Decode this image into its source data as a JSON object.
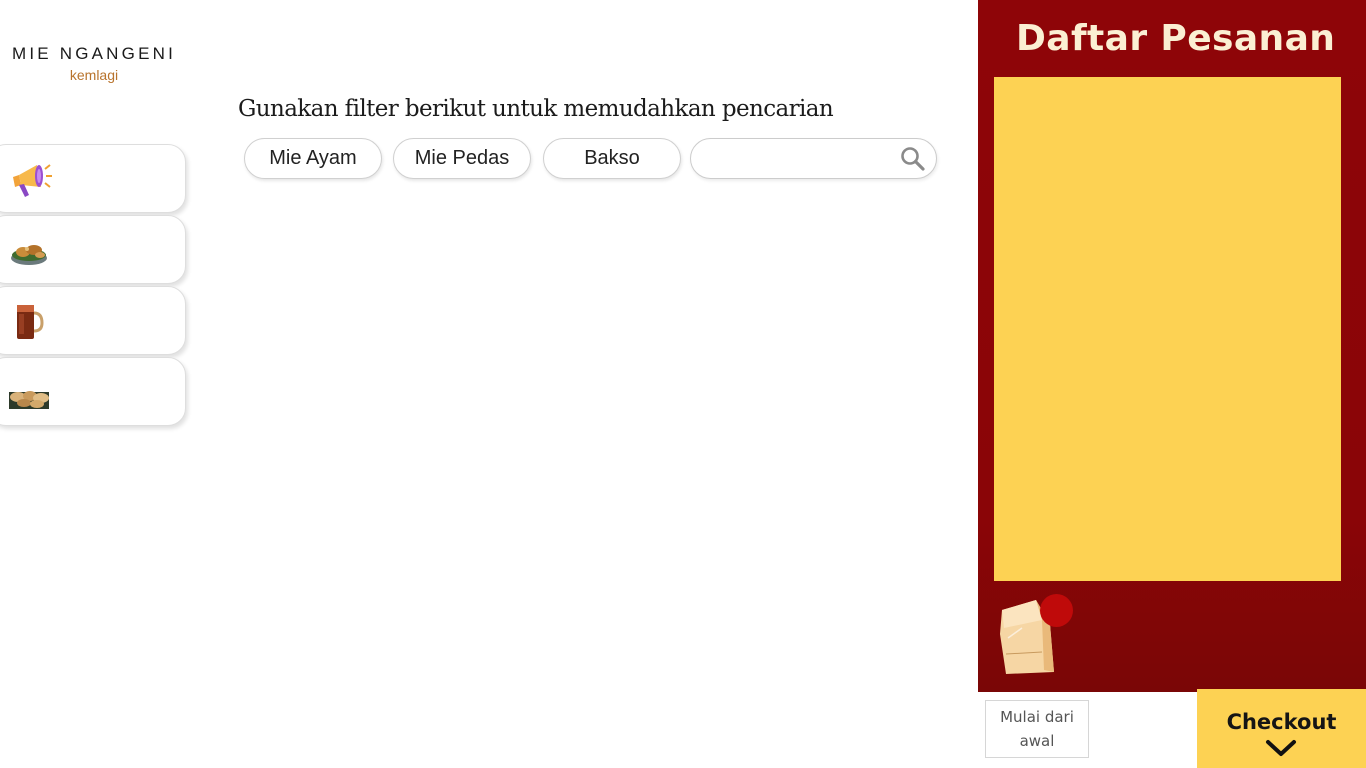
{
  "brand": {
    "name": "MIE NGANGENI",
    "subtitle": "kemlagi"
  },
  "categories": [
    {
      "icon": "megaphone-icon"
    },
    {
      "icon": "noodle-bowl-icon"
    },
    {
      "icon": "iced-tea-icon"
    },
    {
      "icon": "fried-snack-icon"
    }
  ],
  "filter": {
    "title": "Gunakan filter berikut untuk memudahkan pencarian",
    "chips": [
      "Mie Ayam",
      "Mie Pedas",
      "Bakso"
    ],
    "search": {
      "placeholder": "",
      "value": ""
    }
  },
  "order": {
    "title": "Daftar Pesanan",
    "reset_label": "Mulai dari awal",
    "checkout_label": "Checkout"
  },
  "colors": {
    "panel": "#8e0508",
    "accent_yellow": "#fdd253",
    "brand_sub": "#b8732c"
  }
}
